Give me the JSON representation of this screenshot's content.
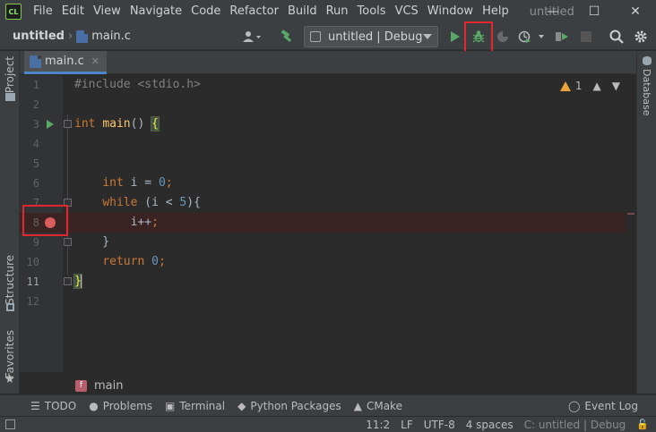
{
  "menubar": {
    "logo": "CL",
    "items": [
      "File",
      "Edit",
      "View",
      "Navigate",
      "Code",
      "Refactor",
      "Build",
      "Run",
      "Tools",
      "VCS",
      "Window",
      "Help"
    ],
    "window_title": "untitled",
    "controls": {
      "minimize": "—",
      "maximize": "☐",
      "close": "✕"
    }
  },
  "toolbar": {
    "project": "untitled",
    "file": "main.c",
    "run_config": "untitled | Debug",
    "icons": [
      "user-icon",
      "build-hammer-icon",
      "run-icon",
      "debug-icon",
      "coverage-icon",
      "profile-icon",
      "attach-icon",
      "stop-icon",
      "search-icon",
      "settings-icon"
    ],
    "colors": {
      "run": "#59a869",
      "debug": "#59a869",
      "highlight": "#e2272f"
    }
  },
  "left_strip": {
    "tabs": [
      "Project",
      "Structure",
      "Favorites"
    ]
  },
  "right_strip": {
    "tabs": [
      "Database"
    ]
  },
  "editor": {
    "tab_label": "main.c",
    "tab_close": "✕",
    "warnings": "1",
    "lines": [
      {
        "n": "1",
        "tokens": [
          {
            "t": "#include <stdio.h>",
            "c": "pre"
          }
        ]
      },
      {
        "n": "2",
        "tokens": []
      },
      {
        "n": "3",
        "tokens": [
          {
            "t": "int",
            "c": "kw"
          },
          {
            "t": " ",
            "c": "txt"
          },
          {
            "t": "main",
            "c": "fn"
          },
          {
            "t": "() ",
            "c": "txt"
          },
          {
            "t": "{",
            "c": "bracehl"
          }
        ]
      },
      {
        "n": "4",
        "tokens": []
      },
      {
        "n": "5",
        "tokens": []
      },
      {
        "n": "6",
        "tokens": [
          {
            "t": "    ",
            "c": "txt"
          },
          {
            "t": "int",
            "c": "kw"
          },
          {
            "t": " i = ",
            "c": "txt"
          },
          {
            "t": "0",
            "c": "num"
          },
          {
            "t": ";",
            "c": "kw"
          }
        ]
      },
      {
        "n": "7",
        "tokens": [
          {
            "t": "    ",
            "c": "txt"
          },
          {
            "t": "while",
            "c": "kw"
          },
          {
            "t": " (i < ",
            "c": "txt"
          },
          {
            "t": "5",
            "c": "num"
          },
          {
            "t": "){",
            "c": "txt"
          }
        ]
      },
      {
        "n": "8",
        "tokens": [
          {
            "t": "        i++",
            "c": "txt"
          },
          {
            "t": ";",
            "c": "kw"
          }
        ]
      },
      {
        "n": "9",
        "tokens": [
          {
            "t": "    }",
            "c": "txt"
          }
        ]
      },
      {
        "n": "10",
        "tokens": [
          {
            "t": "    ",
            "c": "txt"
          },
          {
            "t": "return",
            "c": "kw"
          },
          {
            "t": " ",
            "c": "txt"
          },
          {
            "t": "0",
            "c": "num"
          },
          {
            "t": ";",
            "c": "kw"
          }
        ]
      },
      {
        "n": "11",
        "tokens": [
          {
            "t": "}",
            "c": "bracehl"
          },
          {
            "t": "",
            "c": "caret"
          }
        ]
      },
      {
        "n": "12",
        "tokens": []
      }
    ],
    "breakpoint_line": 8,
    "active_line": 11,
    "run_line": 3
  },
  "crumbbar": {
    "badge": "f",
    "function": "main"
  },
  "toolwindows": [
    {
      "icon": "☰",
      "label": "TODO"
    },
    {
      "icon": "●",
      "label": "Problems"
    },
    {
      "icon": "▣",
      "label": "Terminal"
    },
    {
      "icon": "◆",
      "label": "Python Packages"
    },
    {
      "icon": "▲",
      "label": "CMake"
    }
  ],
  "event_log": {
    "icon": "◯",
    "label": "Event Log"
  },
  "statusbar": {
    "position": "11:2",
    "line_sep": "LF",
    "encoding": "UTF-8",
    "indent": "4 spaces",
    "context": "C: untitled | Debug",
    "lock": "🔓"
  }
}
